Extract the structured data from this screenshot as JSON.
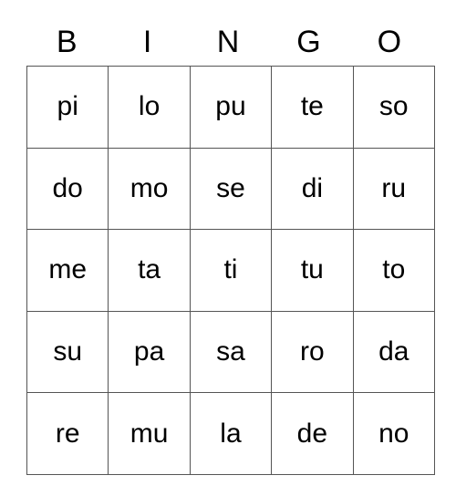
{
  "card": {
    "title": "BINGO",
    "headers": [
      {
        "label": "B"
      },
      {
        "label": "I"
      },
      {
        "label": "N"
      },
      {
        "label": "G"
      },
      {
        "label": "O"
      }
    ],
    "rows": [
      {
        "cells": [
          "pi",
          "lo",
          "pu",
          "te",
          "so"
        ]
      },
      {
        "cells": [
          "do",
          "mo",
          "se",
          "di",
          "ru"
        ]
      },
      {
        "cells": [
          "me",
          "ta",
          "ti",
          "tu",
          "to"
        ]
      },
      {
        "cells": [
          "su",
          "pa",
          "sa",
          "ro",
          "da"
        ]
      },
      {
        "cells": [
          "re",
          "mu",
          "la",
          "de",
          "no"
        ]
      }
    ],
    "colors": {
      "text": "#000000",
      "border": "#555555",
      "background": "#ffffff"
    }
  }
}
